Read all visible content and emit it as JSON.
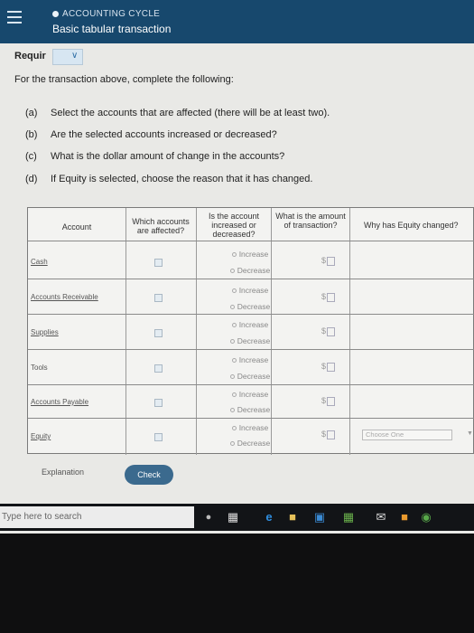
{
  "header": {
    "course": "ACCOUNTING CYCLE",
    "assignment": "Basic tabular transaction"
  },
  "requirement": {
    "tab_label": "Requir",
    "intro": "For the transaction above, complete the following:"
  },
  "questions": [
    {
      "tag": "(a)",
      "text": "Select the accounts that are affected (there will be at least two)."
    },
    {
      "tag": "(b)",
      "text": "Are the selected accounts increased or decreased?"
    },
    {
      "tag": "(c)",
      "text": "What is the dollar amount of change in the accounts?"
    },
    {
      "tag": "(d)",
      "text": "If Equity is selected, choose the reason that it has changed."
    }
  ],
  "table": {
    "headers": {
      "account": "Account",
      "affected": "Which accounts are affected?",
      "inc_dec": "Is the account increased or decreased?",
      "amount": "What is the amount of transaction?",
      "why": "Why has Equity changed?"
    },
    "rows": [
      {
        "account": "Cash"
      },
      {
        "account": "Accounts Receivable"
      },
      {
        "account": "Supplies"
      },
      {
        "account": "Tools"
      },
      {
        "account": "Accounts Payable"
      },
      {
        "account": "Equity"
      }
    ],
    "increase_label": "Increase",
    "decrease_label": "Decrease",
    "currency": "$",
    "equity_placeholder": "Choose One"
  },
  "buttons": {
    "explanation": "Explanation",
    "check": "Check"
  },
  "taskbar": {
    "search_placeholder": "Type here to search"
  }
}
